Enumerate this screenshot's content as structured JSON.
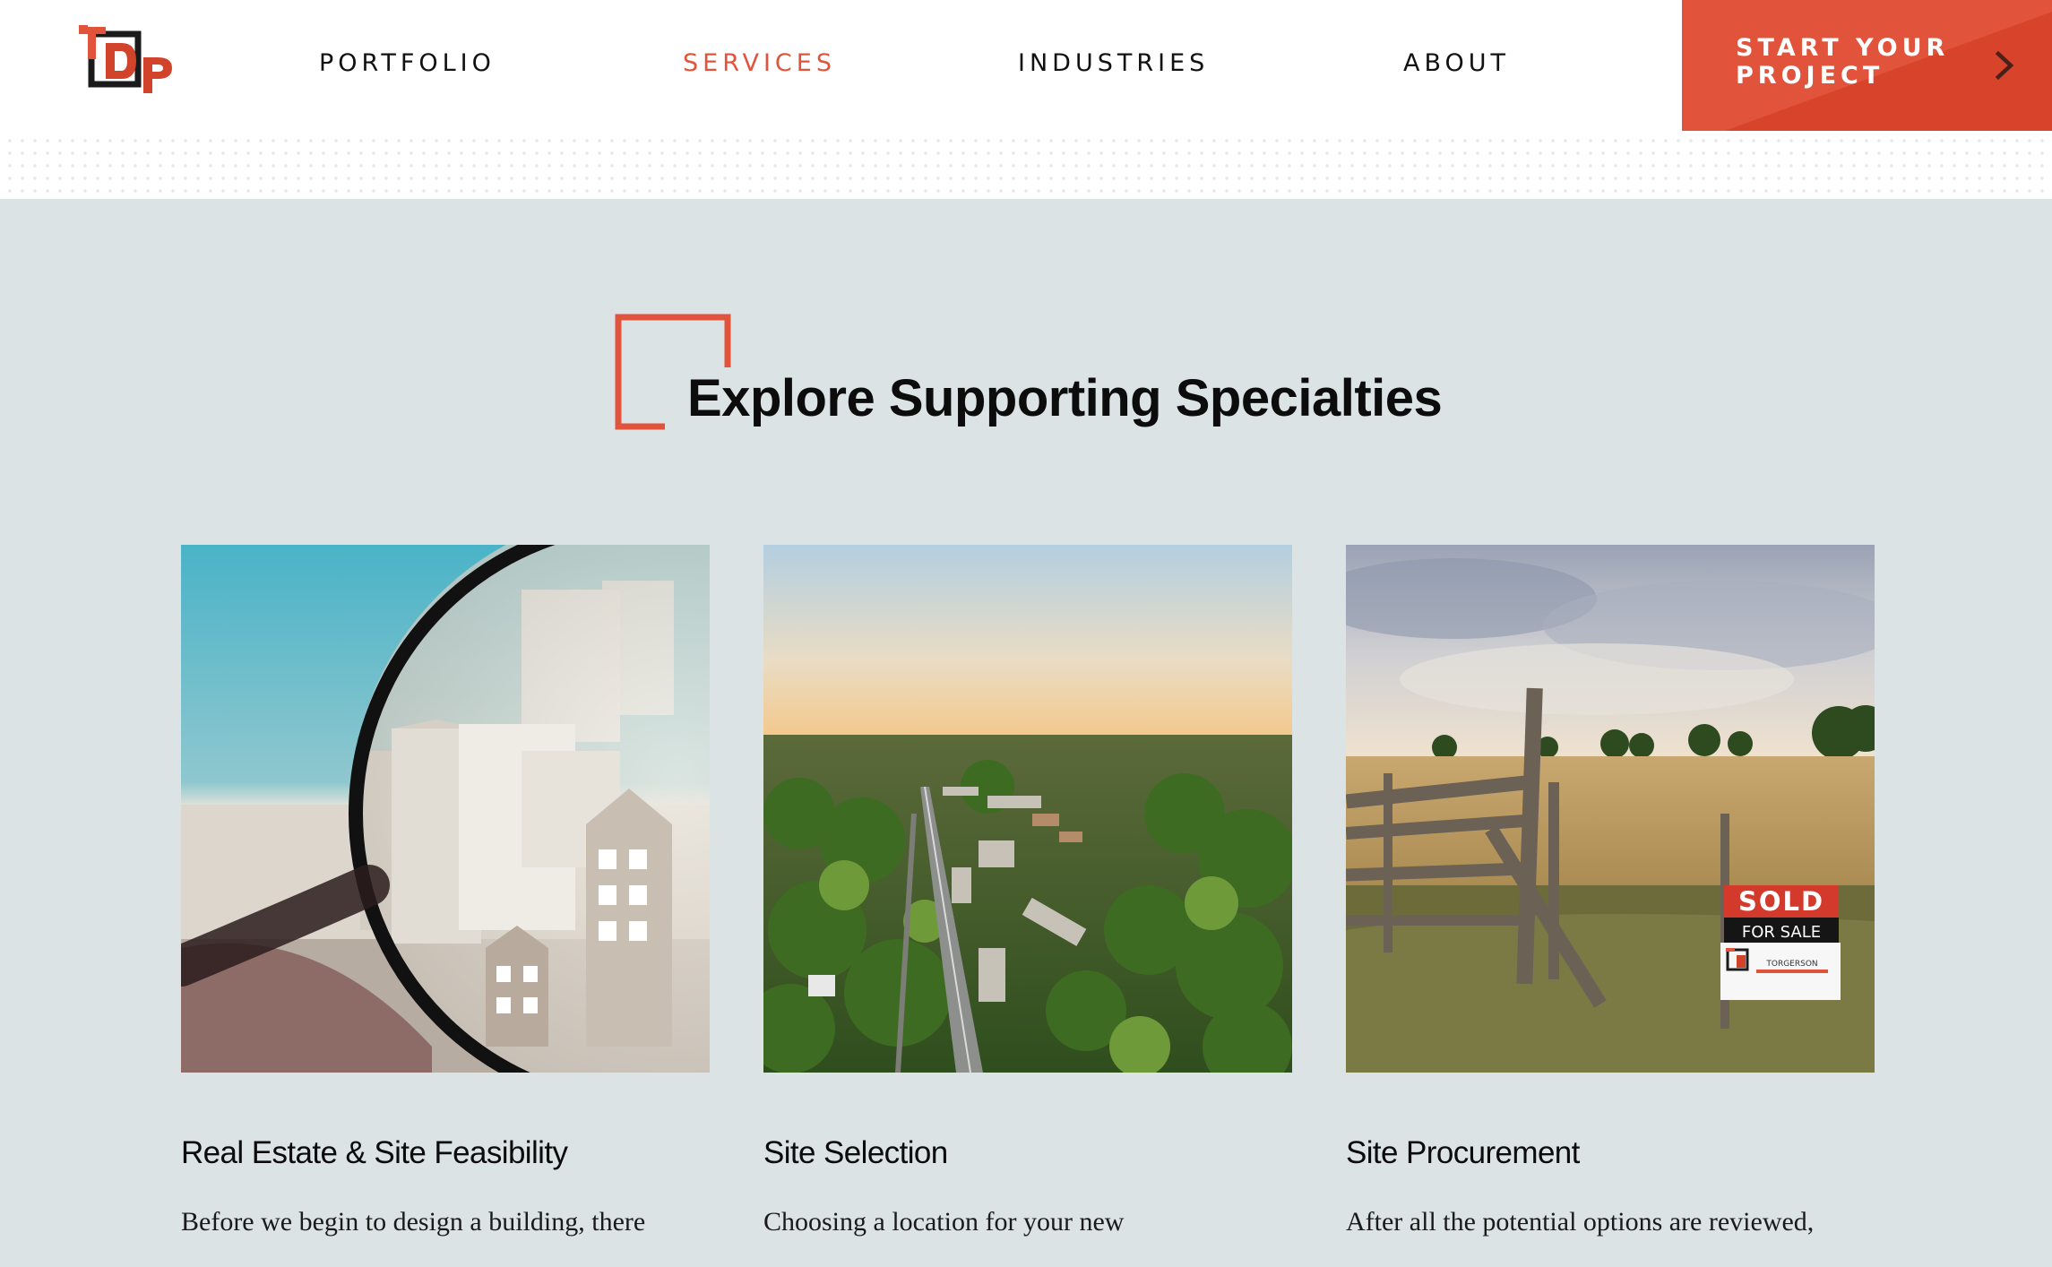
{
  "header": {
    "logo_text": "TDP",
    "nav": [
      {
        "label": "PORTFOLIO",
        "active": false
      },
      {
        "label": "SERVICES",
        "active": true
      },
      {
        "label": "INDUSTRIES",
        "active": false
      },
      {
        "label": "ABOUT",
        "active": false
      }
    ],
    "cta_label": "START YOUR\nPROJECT",
    "cta_icon": "chevron-right-icon"
  },
  "section": {
    "title": "Explore Supporting Specialties"
  },
  "cards": [
    {
      "title": "Real Estate & Site Feasibility",
      "text": "Before we begin to design a building, there",
      "image": "magnifying-glass-over-paper-houses"
    },
    {
      "title": "Site Selection",
      "text": "Choosing a location for your new",
      "image": "aerial-view-of-small-town"
    },
    {
      "title": "Site Procurement",
      "text": "After all the potential options are reviewed,",
      "image": "field-fence-with-sold-sign",
      "sign": {
        "line1": "SOLD",
        "line2": "FOR SALE",
        "line3": "TORGERSON"
      }
    }
  ],
  "colors": {
    "accent": "#e2533b",
    "page_background": "#dce3e5",
    "text": "#111111"
  }
}
